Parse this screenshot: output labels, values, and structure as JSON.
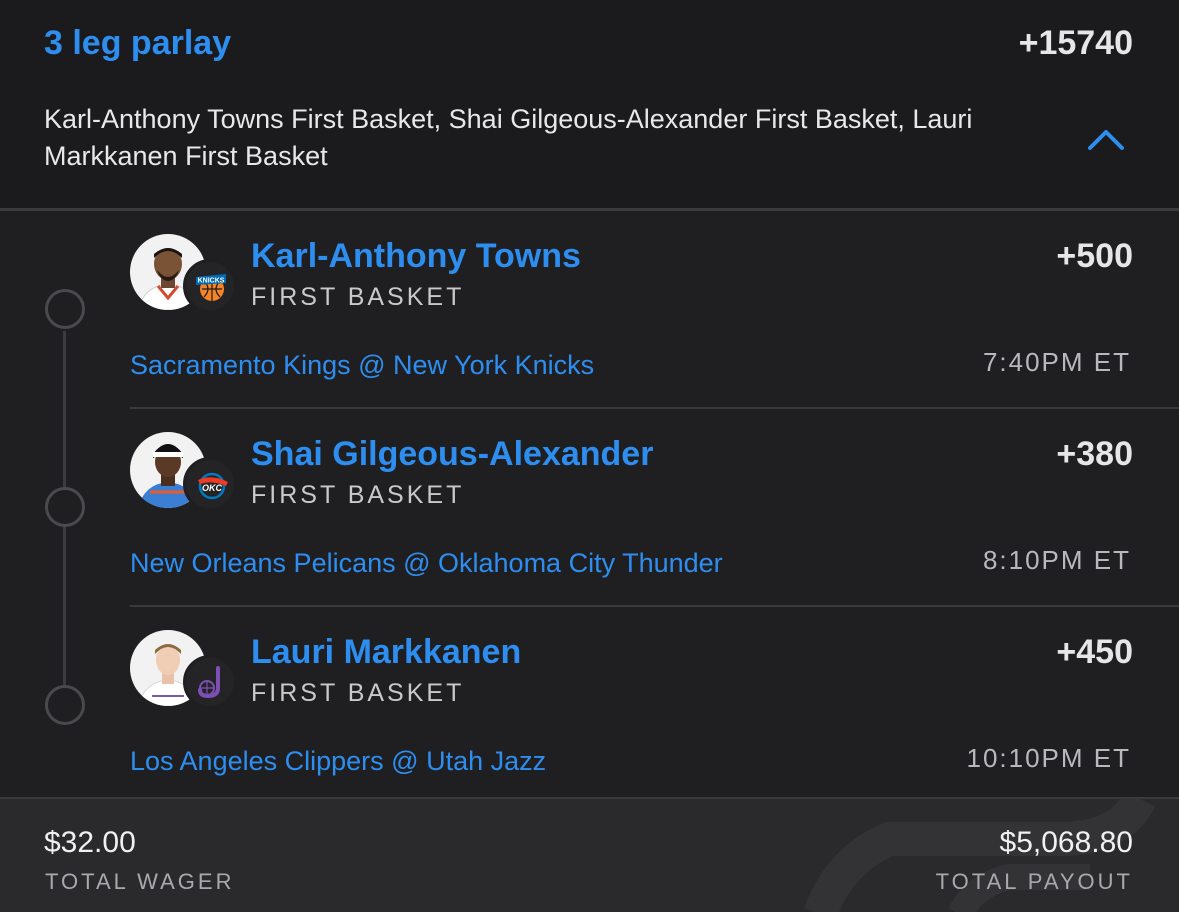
{
  "parlay": {
    "title": "3 leg parlay",
    "odds": "+15740",
    "description": "Karl-Anthony Towns First Basket, Shai Gilgeous-Alexander First Basket, Lauri Markkanen First Basket"
  },
  "legs": [
    {
      "player": "Karl-Anthony Towns",
      "market": "FIRST BASKET",
      "odds": "+500",
      "game": "Sacramento Kings @ New York Knicks",
      "time": "7:40PM ET",
      "team_icon": "knicks-logo-icon"
    },
    {
      "player": "Shai Gilgeous-Alexander",
      "market": "FIRST BASKET",
      "odds": "+380",
      "game": "New Orleans Pelicans @ Oklahoma City Thunder",
      "time": "8:10PM ET",
      "team_icon": "thunder-logo-icon"
    },
    {
      "player": "Lauri Markkanen",
      "market": "FIRST BASKET",
      "odds": "+450",
      "game": "Los Angeles Clippers @ Utah Jazz",
      "time": "10:10PM ET",
      "team_icon": "jazz-logo-icon"
    }
  ],
  "footer": {
    "wager_amount": "$32.00",
    "wager_label": "TOTAL WAGER",
    "payout_amount": "$5,068.80",
    "payout_label": "TOTAL PAYOUT"
  },
  "colors": {
    "accent_blue": "#2e8ef0",
    "background": "#1f1f22",
    "footer_bg": "#2a2a2d"
  }
}
